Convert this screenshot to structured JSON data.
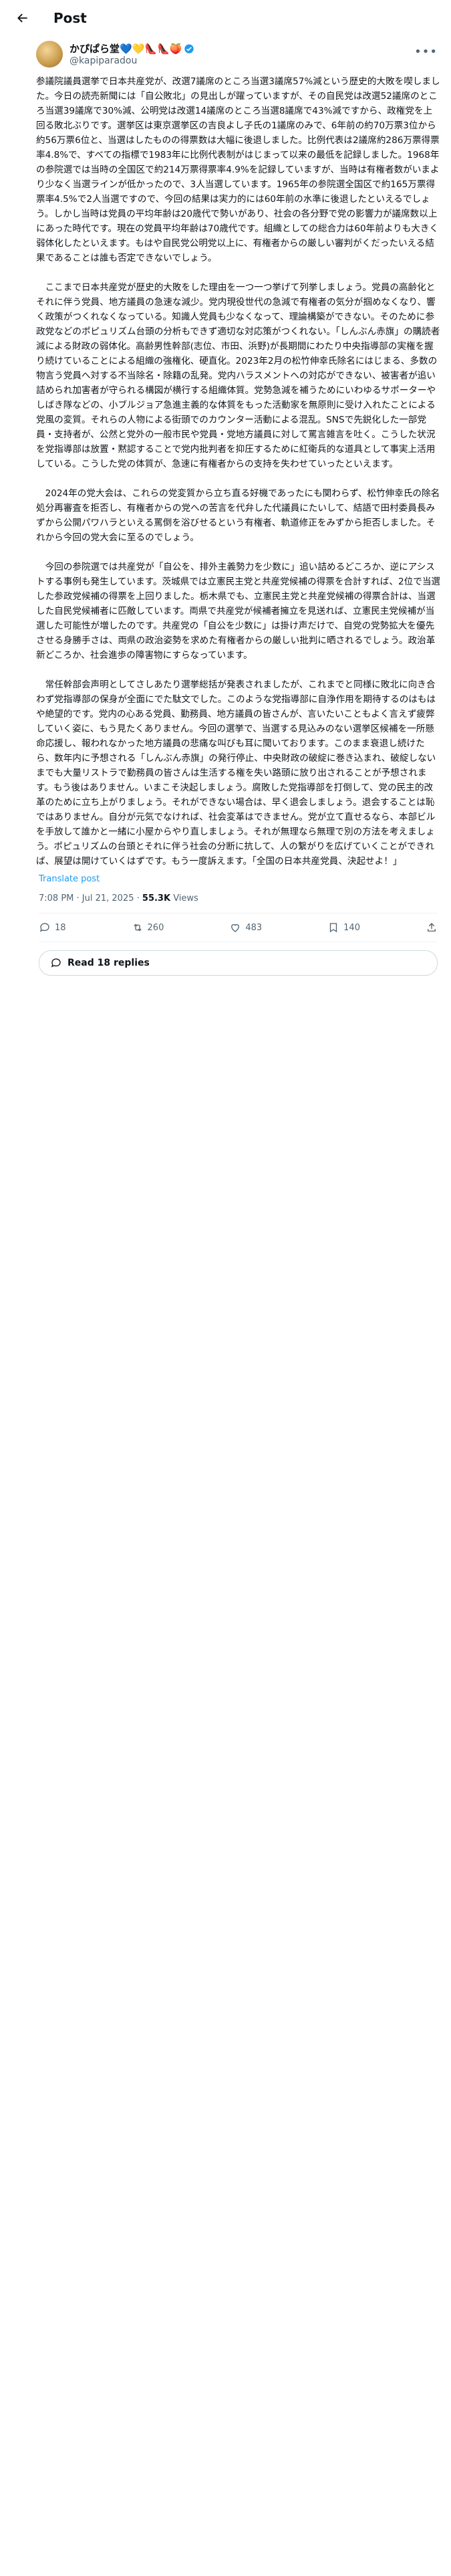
{
  "header": {
    "title": "Post"
  },
  "author": {
    "display_name": "かぴぱら堂💙💛👠👠🍑",
    "handle": "@kapiparadou"
  },
  "post": {
    "text": "参議院議員選挙で日本共産党が、改選7議席のところ当選3議席57%減という歴史的大敗を喫しました。今日の読売新聞には「自公敗北」の見出しが躍っていますが、その自民党は改選52議席のところ当選39議席で30%減、公明党は改選14議席のところ当選8議席で43%減ですから、政権党を上回る敗北ぶりです。選挙区は東京選挙区の吉良よし子氏の1議席のみで、6年前の約70万票3位から約56万票6位と、当選はしたものの得票数は大幅に後退しました。比例代表は2議席約286万票得票率4.8%で、すべての指標で1983年に比例代表制がはじまって以来の最低を記録しました。1968年の参院選では当時の全国区で約214万票得票率4.9%を記録していますが、当時は有権者数がいまより少なく当選ラインが低かったので、3人当選しています。1965年の参院選全国区で約165万票得票率4.5%で2人当選ですので、今回の結果は実力的には60年前の水準に後退したといえるでしょう。しかし当時は党員の平均年齢は20歳代で勢いがあり、社会の各分野で党の影響力が議席数以上にあった時代です。現在の党員平均年齢は70歳代です。組織としての総合力は60年前よりも大きく弱体化したといえます。もはや自民党公明党以上に、有権者からの厳しい審判がくだったいえる結果であることは誰も否定できないでしょう。\n\n　ここまで日本共産党が歴史的大敗をした理由を一つ一つ挙げて列挙しましょう。党員の高齢化とそれに伴う党員、地方議員の急速な減少。党内現役世代の急減で有権者の気分が掴めなくなり、響く政策がつくれなくなっている。知識人党員も少なくなって、理論構築ができない。そのために参政党などのポピュリズム台頭の分析もできず適切な対応策がつくれない。「しんぶん赤旗」の購読者減による財政の弱体化。高齢男性幹部(志位、市田、浜野)が長期間にわたり中央指導部の実権を握り続けていることによる組織の強権化、硬直化。2023年2月の松竹伸幸氏除名にはじまる、多数の物言う党員へ対する不当除名・除籍の乱発。党内ハラスメントへの対応ができない、被害者が追い詰められ加害者が守られる構図が横行する組織体質。党勢急減を補うためにいわゆるサポーターやしばき隊などの、小ブルジョア急進主義的な体質をもった活動家を無原則に受け入れたことによる党風の変質。それらの人物による街頭でのカウンター活動による混乱。SNSで先鋭化した一部党員・支持者が、公然と党外の一般市民や党員・党地方議員に対して罵言雑言を吐く。こうした状況を党指導部は放置・黙認することで党内批判者を抑圧するために紅衛兵的な道具として事実上活用している。こうした党の体質が、急速に有権者からの支持を失わせていったといえます。\n\n　2024年の党大会は、これらの党変質から立ち直る好機であったにも関わらず、松竹伸幸氏の除名処分再審査を拒否し、有権者からの党への苦言を代弁した代議員にたいして、結語で田村委員長みずから公開パワハラといえる罵倒を浴びせるという有権者、軌道修正をみずから拒否しました。それから今回の党大会に至るのでしょう。\n\n　今回の参院選では共産党が「自公を、排外主義勢力を少数に」追い詰めるどころか、逆にアシストする事例も発生しています。茨城県では立憲民主党と共産党候補の得票を合計すれば、2位で当選した参政党候補の得票を上回りました。栃木県でも、立憲民主党と共産党候補の得票合計は、当選した自民党候補者に匹敵しています。両県で共産党が候補者擁立を見送れば、立憲民主党候補が当選した可能性が増したのです。共産党の「自公を少数に」は掛け声だけで、自党の党勢拡大を優先させる身勝手さは、両県の政治姿勢を求めた有権者からの厳しい批判に晒されるでしょう。政治革新どころか、社会進歩の障害物にすらなっています。\n\n　常任幹部会声明としてさしあたり選挙総括が発表されましたが、これまでと同様に敗北に向き合わず党指導部の保身が全面にでた駄文でした。このような党指導部に自浄作用を期待するのはもはや絶望的です。党内の心ある党員、勤務員、地方議員の皆さんが、言いたいこともよく言えず疲弊していく姿に、もう見たくありません。今回の選挙で、当選する見込みのない選挙区候補を一所懸命応援し、報われなかった地方議員の悲痛な叫びも耳に聞いております。このまま衰退し続けたら、数年内に予想される「しんぶん赤旗」の発行停止、中央財政の破綻に巻き込まれ、破綻しないまでも大量リストラで勤務員の皆さんは生活する権を失い路頭に放り出されることが予想されます。もう後はありません。いまこそ決起しましょう。腐敗した党指導部を打倒して、党の民主的改革のために立ち上がりましょう。それができない場合は、早く退会しましょう。退会することは恥ではありません。自分が元気でなければ、社会変革はできません。党が立て直せるなら、本部ビルを手放して誰かと一緒に小屋からやり直しましょう。それが無理なら無理で別の方法を考えましょう。ポピュリズムの台頭とそれに伴う社会の分断に抗して、人の繋がりを広げていくことができれば、展望は開けていくはずです。もう一度訴えます。「全国の日本共産党員、決起せよ！」",
    "translate_label": "Translate post",
    "time": "7:08 PM · Jul 21, 2025",
    "views_count": "55.3K",
    "views_label": "Views"
  },
  "actions": {
    "replies": "18",
    "reposts": "260",
    "likes": "483",
    "bookmarks": "140"
  },
  "read_replies": "Read 18 replies",
  "colors": {
    "link": "#1d9bf0",
    "muted": "#536471",
    "verified": "#1d9bf0"
  }
}
